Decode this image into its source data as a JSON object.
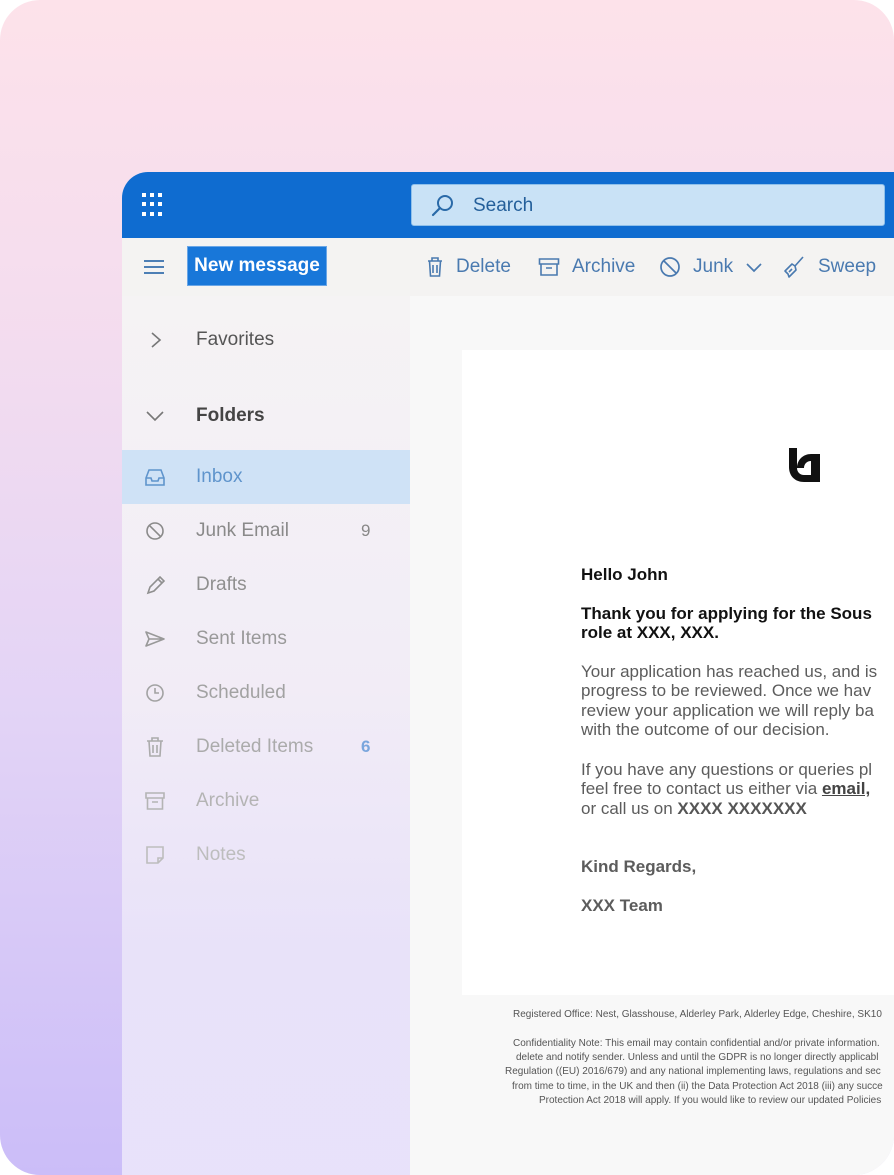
{
  "search": {
    "placeholder": "Search"
  },
  "commandbar": {
    "new_message": "New message",
    "delete": "Delete",
    "archive": "Archive",
    "junk": "Junk",
    "sweep": "Sweep"
  },
  "nav": {
    "favorites": "Favorites",
    "folders": "Folders",
    "items": [
      {
        "label": "Inbox",
        "count": ""
      },
      {
        "label": "Junk Email",
        "count": "9"
      },
      {
        "label": "Drafts",
        "count": ""
      },
      {
        "label": "Sent Items",
        "count": ""
      },
      {
        "label": "Scheduled",
        "count": ""
      },
      {
        "label": "Deleted Items",
        "count": "6"
      },
      {
        "label": "Archive",
        "count": ""
      },
      {
        "label": "Notes",
        "count": ""
      }
    ]
  },
  "email": {
    "greeting": "Hello John",
    "subject_line1": "Thank you for applying for the Sous",
    "subject_line2": "role at XXX, XXX.",
    "para1_line1": "Your application has reached us, and is",
    "para1_line2": "progress to be reviewed. Once we hav",
    "para1_line3": "review your application we will reply ba",
    "para1_line4": "with the outcome of our decision.",
    "para2_line1": "If you have any questions or queries pl",
    "para2_line2_text": "feel free to contact us either via ",
    "para2_line2_link": "email,",
    "para2_line3_text": "or call us on ",
    "para2_line3_phone": "XXXX XXXXXXX",
    "signoff": "Kind Regards,",
    "team": "XXX Team",
    "footer": [
      "Registered Office: Nest, Glasshouse, Alderley Park, Alderley Edge, Cheshire, SK10",
      "Confidentiality Note: This email may contain confidential and/or private information.",
      "delete and notify sender. Unless and until the GDPR is no longer directly applicabl",
      "Regulation ((EU) 2016/679) and any national implementing laws, regulations and sec",
      "from time to time, in the UK and then (ii) the Data Protection Act 2018 (iii) any succe",
      "Protection Act 2018 will apply. If you would like to review our updated Policies"
    ]
  },
  "colors": {
    "brand_blue": "#0f6cd0",
    "selected_row": "#cfe2f6",
    "accent_count": "#5a8fd0"
  }
}
